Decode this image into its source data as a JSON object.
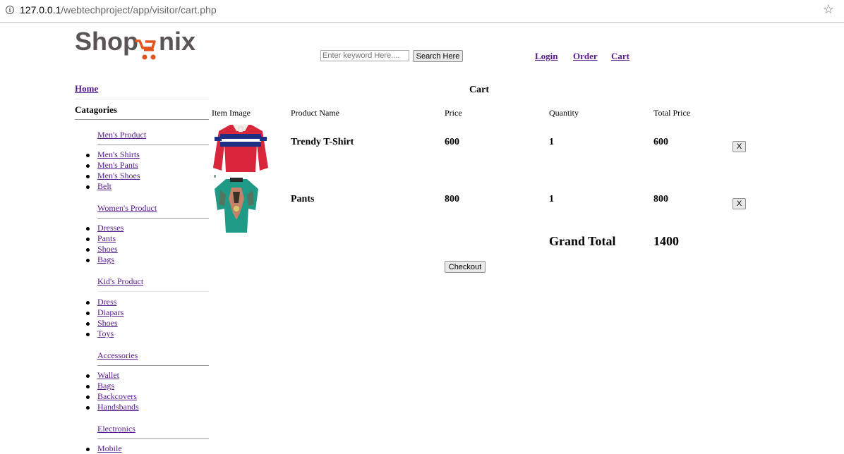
{
  "browser": {
    "url_host": "127.0.0.1",
    "url_path": "/webtechproject/app/visitor/cart.php"
  },
  "header": {
    "logo_text_left": "Shop",
    "logo_text_right": "nix",
    "search_placeholder": "Enter keyword Here....",
    "search_button": "Search Here",
    "nav": {
      "login": "Login",
      "order": "Order",
      "cart": "Cart"
    }
  },
  "sidebar": {
    "home": "Home",
    "categories_title": "Catagories",
    "groups": [
      {
        "title": "Men's Product",
        "items": [
          "Men's Shirts",
          "Men's Pants",
          "Men's Shoes",
          "Belt"
        ]
      },
      {
        "title": "Women's Product",
        "items": [
          "Dresses",
          "Pants",
          "Shoes",
          "Bags"
        ]
      },
      {
        "title": "Kid's Product",
        "items": [
          "Dress",
          "Diapars",
          "Shoes",
          "Toys"
        ]
      },
      {
        "title": "Accessories",
        "items": [
          "Wallet",
          "Bags",
          "Backcovers",
          "Handsbands"
        ]
      },
      {
        "title": "Electronics",
        "items": [
          "Mobile"
        ]
      }
    ]
  },
  "cart": {
    "title": "Cart",
    "columns": [
      "Item Image",
      "Product Name",
      "Price",
      "Quantity",
      "Total Price"
    ],
    "rows": [
      {
        "name": "Trendy T-Shirt",
        "price": "600",
        "quantity": "1",
        "total": "600",
        "remove": "X"
      },
      {
        "name": "Pants",
        "price": "800",
        "quantity": "1",
        "total": "800",
        "remove": "X"
      }
    ],
    "grand_total_label": "Grand Total",
    "grand_total_value": "1400",
    "checkout": "Checkout"
  },
  "colors": {
    "link": "#551a8b",
    "logo_gray": "#5b5456",
    "logo_orange": "#e2541c"
  }
}
